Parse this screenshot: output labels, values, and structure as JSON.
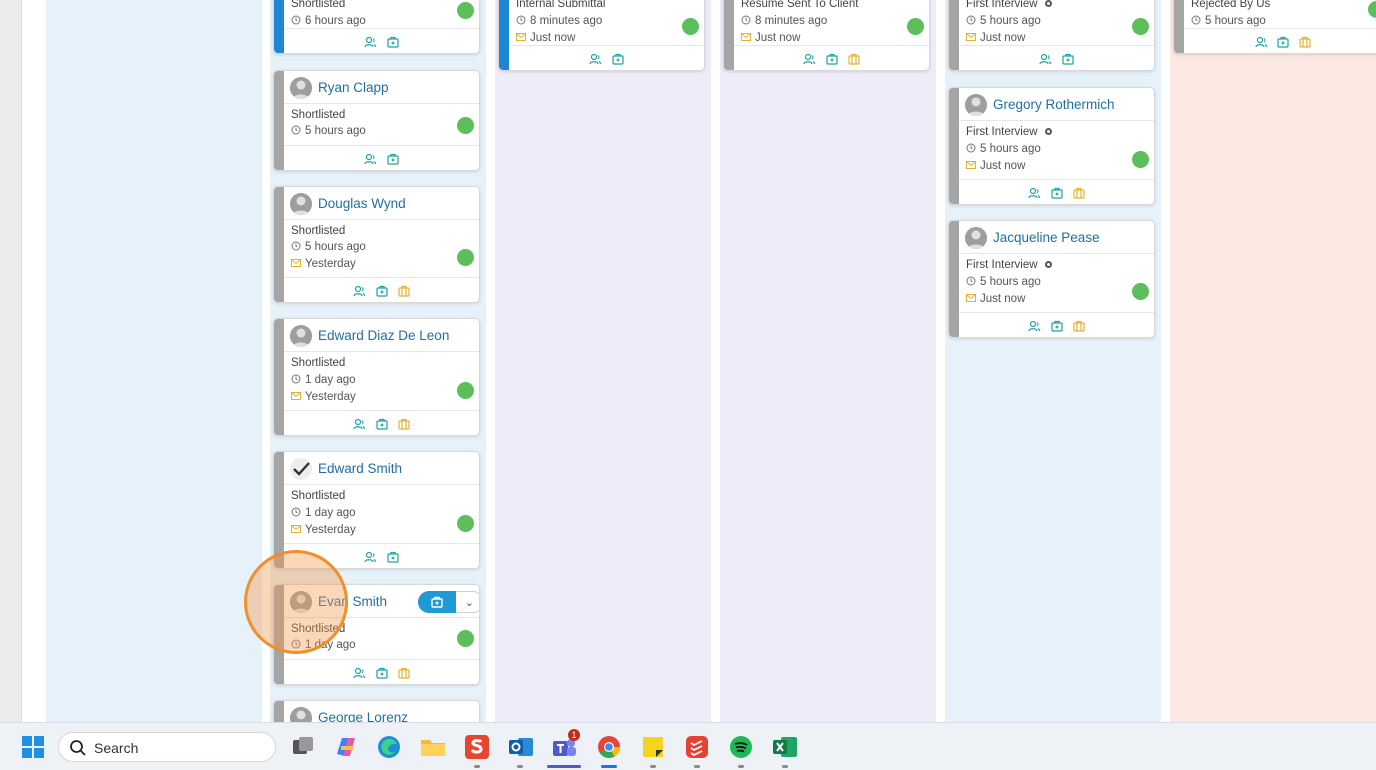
{
  "colors": {
    "accent_blue": "#1f9ad6",
    "name_blue": "#1f6fa3",
    "teal_icon": "#1aa3a3",
    "yellow_icon": "#e6b22e",
    "status_green": "#5cbf5c",
    "stripe_blue": "#1f86d1",
    "stripe_gray": "#a5a5a5",
    "col_blue": "#e6f1fa",
    "col_purple": "#efecf9",
    "col_pink": "#fbe8e3"
  },
  "columns": {
    "col1": {
      "cards": [
        {
          "name": "",
          "status": "Shortlisted",
          "time": "6 hours ago",
          "email": ""
        },
        {
          "name": "Ryan Clapp",
          "status": "Shortlisted",
          "time": "5 hours ago",
          "email": ""
        },
        {
          "name": "Douglas Wynd",
          "status": "Shortlisted",
          "time": "5 hours ago",
          "email": "Yesterday"
        },
        {
          "name": "Edward Diaz De Leon",
          "status": "Shortlisted",
          "time": "1 day ago",
          "email": "Yesterday"
        },
        {
          "name": "Edward Smith",
          "status": "Shortlisted",
          "time": "1 day ago",
          "email": "Yesterday"
        },
        {
          "name": "Evan Smith",
          "status": "Shortlisted",
          "time": "1 day ago",
          "email": ""
        },
        {
          "name": "George Lorenz",
          "status": "",
          "time": "",
          "email": ""
        }
      ]
    },
    "col2": {
      "cards": [
        {
          "status": "Internal Submittal",
          "time": "8 minutes ago",
          "email": "Just now"
        }
      ]
    },
    "col3": {
      "cards": [
        {
          "status": "Resume Sent To Client",
          "time": "8 minutes ago",
          "email": "Just now"
        }
      ]
    },
    "col4": {
      "cards": [
        {
          "name": "",
          "status": "First Interview",
          "time": "5 hours ago",
          "email": "Just now"
        },
        {
          "name": "Gregory Rothermich",
          "status": "First Interview",
          "time": "5 hours ago",
          "email": "Just now"
        },
        {
          "name": "Jacqueline Pease",
          "status": "First Interview",
          "time": "5 hours ago",
          "email": "Just now"
        }
      ]
    },
    "col5": {
      "cards": [
        {
          "status": "Rejected By Us",
          "time": "5 hours ago"
        }
      ]
    }
  },
  "taskbar": {
    "search_placeholder": "Search",
    "teams_badge": "1",
    "apps": [
      "windows-start-icon",
      "search-icon",
      "task-view-icon",
      "copilot-icon",
      "edge-icon",
      "file-explorer-icon",
      "snagit-icon",
      "outlook-icon",
      "teams-icon",
      "chrome-icon",
      "sticky-notes-icon",
      "todoist-icon",
      "spotify-icon",
      "excel-icon"
    ]
  }
}
